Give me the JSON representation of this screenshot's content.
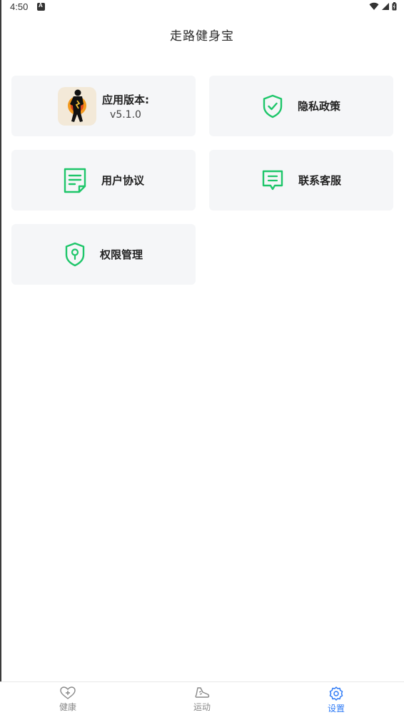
{
  "status_bar": {
    "time": "4:50"
  },
  "header": {
    "title": "走路健身宝"
  },
  "cards": {
    "version": {
      "label": "应用版本:",
      "value": "v5.1.0",
      "icon": "runner-logo-icon"
    },
    "privacy": {
      "label": "隐私政策",
      "icon": "shield-check-icon"
    },
    "agreement": {
      "label": "用户协议",
      "icon": "document-icon"
    },
    "support": {
      "label": "联系客服",
      "icon": "chat-icon"
    },
    "permissions": {
      "label": "权限管理",
      "icon": "shield-lock-icon"
    }
  },
  "bottom_nav": {
    "items": [
      {
        "label": "健康",
        "icon": "heart-plus-icon",
        "active": false
      },
      {
        "label": "运动",
        "icon": "shoe-icon",
        "active": false
      },
      {
        "label": "设置",
        "icon": "gear-icon",
        "active": true
      }
    ]
  },
  "colors": {
    "accent_green": "#1ec66a",
    "active_blue": "#2f7bf6",
    "card_bg": "#f5f6f8"
  }
}
